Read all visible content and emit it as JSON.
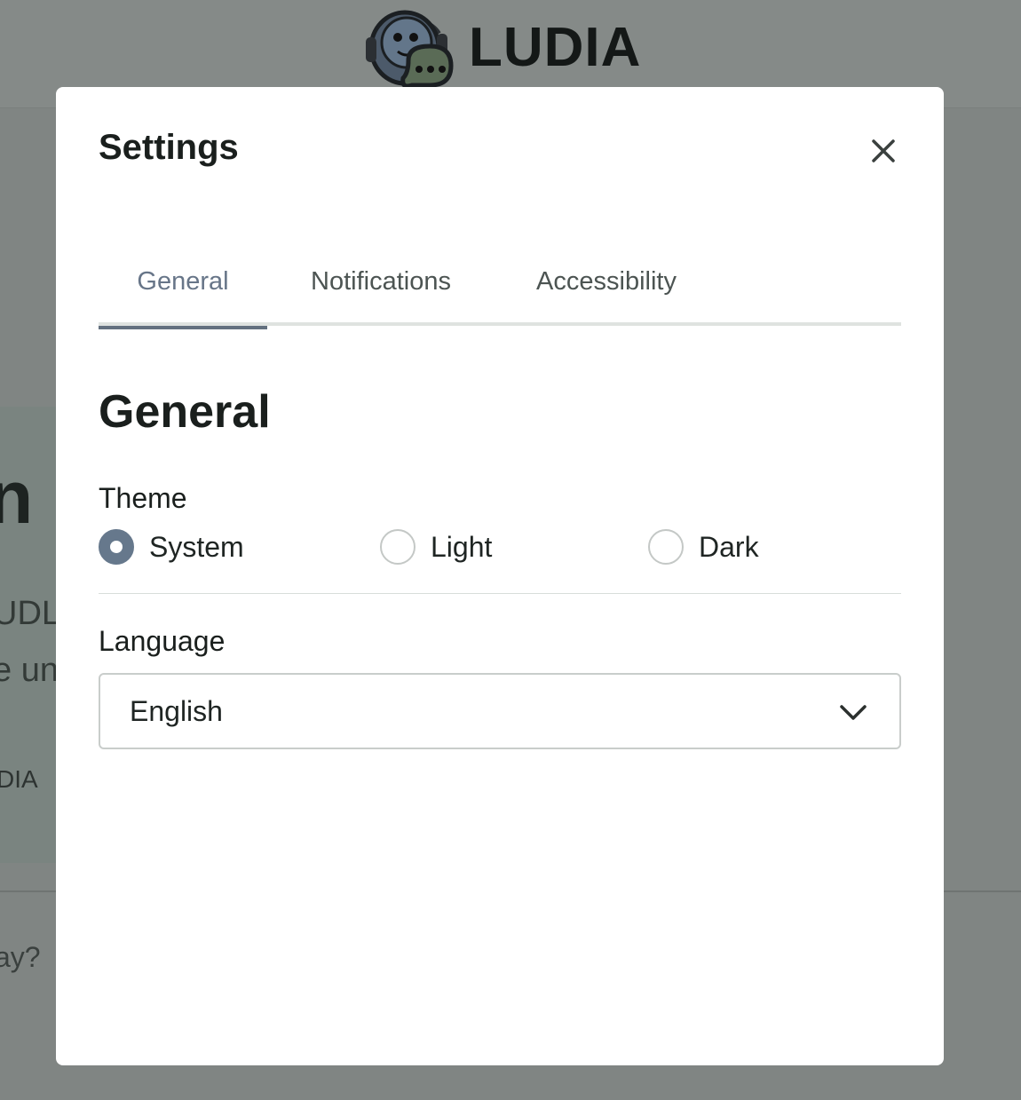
{
  "app": {
    "brand": "LUDIA"
  },
  "background": {
    "hero_title": "n L",
    "hero_line1": "UDL",
    "hero_line2": "e un",
    "hero_tag": "DIA",
    "question": "ay?"
  },
  "modal": {
    "title": "Settings",
    "close_icon": "close-icon",
    "tabs": [
      {
        "label": "General",
        "active": true
      },
      {
        "label": "Notifications",
        "active": false
      },
      {
        "label": "Accessibility",
        "active": false
      }
    ],
    "section_title": "General",
    "theme": {
      "label": "Theme",
      "options": [
        {
          "label": "System",
          "checked": true
        },
        {
          "label": "Light",
          "checked": false
        },
        {
          "label": "Dark",
          "checked": false
        }
      ]
    },
    "language": {
      "label": "Language",
      "selected": "English",
      "chevron_icon": "chevron-down-icon"
    }
  },
  "colors": {
    "overlay": "#808583",
    "accent": "#66788c",
    "tab_active_text": "#677588",
    "text": "#1a1f1d"
  }
}
